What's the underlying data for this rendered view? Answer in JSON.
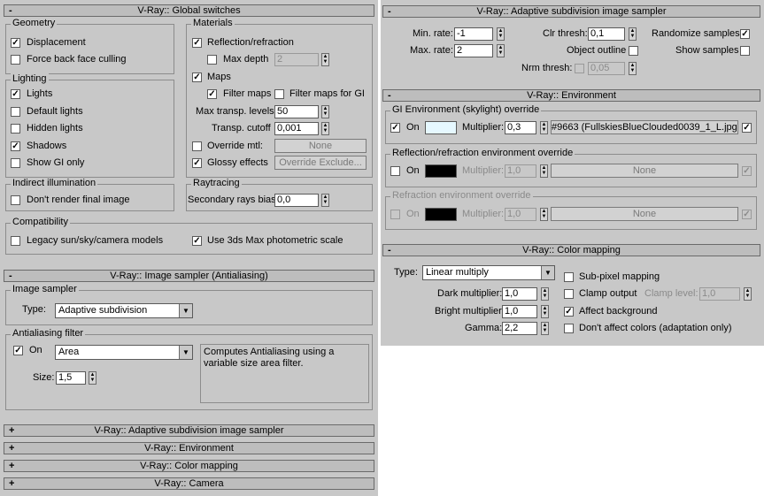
{
  "global": {
    "title": "V-Ray:: Global switches",
    "geometry": {
      "title": "Geometry",
      "displacement": "Displacement",
      "force_back": "Force back face culling"
    },
    "lighting": {
      "title": "Lighting",
      "lights": "Lights",
      "default_lights": "Default lights",
      "hidden_lights": "Hidden lights",
      "shadows": "Shadows",
      "show_gi": "Show GI only"
    },
    "indirect": {
      "title": "Indirect illumination",
      "dont_render": "Don't render final image"
    },
    "materials": {
      "title": "Materials",
      "refl": "Reflection/refraction",
      "max_depth": "Max depth",
      "max_depth_val": "2",
      "maps": "Maps",
      "filter_maps": "Filter maps",
      "filter_gi": "Filter maps for GI",
      "max_transp": "Max transp. levels",
      "max_transp_val": "50",
      "transp_cutoff": "Transp. cutoff",
      "transp_cutoff_val": "0,001",
      "override_mtl": "Override mtl:",
      "none_btn": "None",
      "glossy": "Glossy effects",
      "override_excl": "Override Exclude..."
    },
    "raytracing": {
      "title": "Raytracing",
      "bias": "Secondary rays bias",
      "bias_val": "0,0"
    },
    "compat": {
      "title": "Compatibility",
      "legacy": "Legacy sun/sky/camera models",
      "photometric": "Use 3ds Max photometric scale"
    }
  },
  "sampler": {
    "title": "V-Ray:: Image sampler (Antialiasing)",
    "image_sampler": {
      "title": "Image sampler",
      "type_label": "Type:",
      "type_value": "Adaptive subdivision"
    },
    "aa": {
      "title": "Antialiasing filter",
      "on": "On",
      "filter": "Area",
      "desc": "Computes Antialiasing using a variable size area filter.",
      "size_label": "Size:",
      "size_val": "1,5"
    }
  },
  "collapsed": [
    "V-Ray:: Adaptive subdivision image sampler",
    "V-Ray:: Environment",
    "V-Ray:: Color mapping",
    "V-Ray:: Camera"
  ],
  "adaptive": {
    "title": "V-Ray:: Adaptive subdivision image sampler",
    "min_rate": "Min. rate:",
    "min_rate_val": "-1",
    "max_rate": "Max. rate:",
    "max_rate_val": "2",
    "clr_thresh": "Clr thresh:",
    "clr_thresh_val": "0,1",
    "obj_outline": "Object outline",
    "nrm_thresh": "Nrm thresh:",
    "nrm_thresh_val": "0,05",
    "randomize": "Randomize samples",
    "show_samples": "Show samples"
  },
  "environment": {
    "title": "V-Ray:: Environment",
    "gi": {
      "title": "GI Environment (skylight) override",
      "on": "On",
      "mult": "Multiplier:",
      "mult_val": "0,3",
      "map": "#9663 (FullskiesBlueClouded0039_1_L.jpg)",
      "color": "#e6f8ff"
    },
    "refl": {
      "title": "Reflection/refraction environment override",
      "on": "On",
      "mult": "Multiplier:",
      "mult_val": "1,0",
      "map": "None",
      "color": "#000000"
    },
    "refr": {
      "title": "Refraction environment override",
      "on": "On",
      "mult": "Multiplier:",
      "mult_val": "1,0",
      "map": "None",
      "color": "#000000"
    }
  },
  "colormap": {
    "title": "V-Ray:: Color mapping",
    "type_label": "Type:",
    "type_value": "Linear multiply",
    "dark": "Dark multiplier:",
    "dark_val": "1,0",
    "bright": "Bright multiplier:",
    "bright_val": "1,0",
    "gamma": "Gamma:",
    "gamma_val": "2,2",
    "subpixel": "Sub-pixel mapping",
    "clamp": "Clamp output",
    "clamp_level": "Clamp level:",
    "clamp_level_val": "1,0",
    "affect_bg": "Affect background",
    "dont_affect": "Don't affect colors (adaptation only)"
  },
  "signs": {
    "expanded": "-",
    "collapsed": "+"
  },
  "glyphs": {
    "check": "✓",
    "up": "▲",
    "down": "▼"
  }
}
